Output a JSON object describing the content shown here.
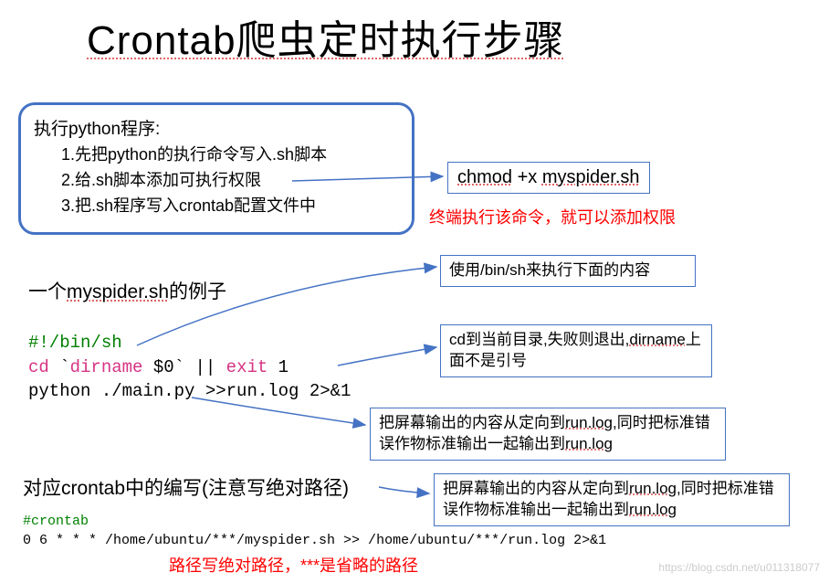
{
  "title": "Crontab爬虫定时执行步骤",
  "box1": {
    "header": "执行python程序:",
    "i1": "1.先把python的执行命令写入.sh脚本",
    "i2": "2.给.sh脚本添加可执行权限",
    "i3": "3.把.sh程序写入crontab配置文件中"
  },
  "chmod": {
    "cmd": "chmod",
    "opt": " +x  ",
    "file": "myspider.sh"
  },
  "red1": "终端执行该命令，就可以添加权限",
  "sec2": {
    "p1": "一个",
    "p2": "myspider.sh",
    "p3": "的例子"
  },
  "code1": {
    "l1": "#!/bin/sh",
    "l2a": "cd",
    "l2b": " `",
    "l2c": "dirname",
    "l2d": " $0` || ",
    "l2e": "exit",
    "l2f": " 1",
    "l3": "python ./main.py >>run.log 2>&1"
  },
  "nb2": "使用/bin/sh来执行下面的内容",
  "nb3": {
    "a": "cd到当前目录,失败则退出,",
    "b": "dirname",
    "c": "上面不是引号"
  },
  "nb4": {
    "a": "把屏幕输出的内容从定向到",
    "b": "run.log",
    "c": ",同时把标准错误作物标准输出一起输出到",
    "d": "run.log"
  },
  "nb5": {
    "a": "把屏幕输出的内容从定向到",
    "b": "run.log",
    "c": ",同时把标准错误作物标准输出一起输出到",
    "d": "run.log"
  },
  "sec3": "对应crontab中的编写(注意写绝对路径)",
  "code2": {
    "l1": "#crontab",
    "l2": "0 6 * * * /home/ubuntu/***/myspider.sh >> /home/ubuntu/***/run.log 2>&1"
  },
  "red2": "路径写绝对路径，***是省略的路径",
  "watermark": "https://blog.csdn.net/u011318077"
}
